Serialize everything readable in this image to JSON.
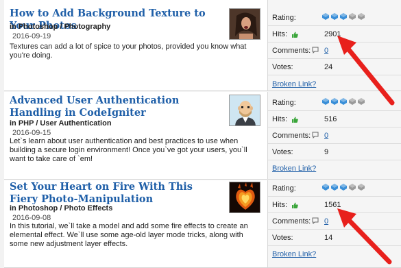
{
  "listings": [
    {
      "title": "How to Add Background Texture to Your Photos",
      "category_prefix": "in",
      "category": "Photoshop / Photography",
      "date": "2016-09-19",
      "description": "Textures can add a lot of spice to your photos, provided you know what you're doing.",
      "thumbnail_icon": "woman-portrait-thumbnail",
      "rating_label": "Rating:",
      "rating": 3,
      "rating_max": 5,
      "hits_label": "Hits:",
      "hits": "2901",
      "comments_label": "Comments:",
      "comments": "0",
      "votes_label": "Votes:",
      "votes": "24",
      "broken_link": "Broken Link?"
    },
    {
      "title": "Advanced User Authentication Handling in CodeIgniter",
      "category_prefix": "in",
      "category": "PHP / User Authentication",
      "date": "2016-09-15",
      "description": "Let`s learn about user authentication and best practices to use when building a secure login environment! Once you`ve got your users, you`ll want to take care of `em!",
      "thumbnail_icon": "bald-man-avatar-thumbnail",
      "rating_label": "Rating:",
      "rating": 3,
      "rating_max": 5,
      "hits_label": "Hits:",
      "hits": "516",
      "comments_label": "Comments:",
      "comments": "0",
      "votes_label": "Votes:",
      "votes": "9",
      "broken_link": "Broken Link?"
    },
    {
      "title": "Set Your Heart on Fire With This Fiery Photo-Manipulation",
      "category_prefix": "in",
      "category": "Photoshop / Photo Effects",
      "date": "2016-09-08",
      "description": "In this tutorial, we`ll take a model and add some fire effects to create an elemental effect. We`ll use some age-old layer mode tricks, along with some new adjustment layer effects.",
      "thumbnail_icon": "fire-heart-thumbnail",
      "rating_label": "Rating:",
      "rating": 3,
      "rating_max": 5,
      "hits_label": "Hits:",
      "hits": "1561",
      "comments_label": "Comments:",
      "comments": "0",
      "votes_label": "Votes:",
      "votes": "14",
      "broken_link": "Broken Link?"
    }
  ],
  "colors": {
    "link": "#1f5fa8",
    "star_on": "#3a8fd8",
    "star_off": "#9a9a9a",
    "arrow": "#e8201c",
    "thumb_up": "#3aa53a"
  }
}
